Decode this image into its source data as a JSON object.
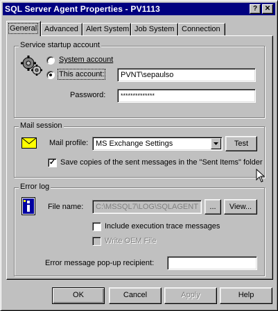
{
  "window": {
    "title": "SQL Server Agent Properties - PV1113",
    "help_button": "?",
    "close_button": "✕"
  },
  "tabs": [
    {
      "label": "General",
      "active": true
    },
    {
      "label": "Advanced",
      "active": false
    },
    {
      "label": "Alert System",
      "active": false
    },
    {
      "label": "Job System",
      "active": false
    },
    {
      "label": "Connection",
      "active": false
    }
  ],
  "service": {
    "group_label": "Service startup account",
    "system_account_label": "System account",
    "this_account_label": "This account:",
    "account_value": "PVNT\\sepaulso",
    "password_label": "Password:",
    "password_value": "**************"
  },
  "mail": {
    "group_label": "Mail session",
    "profile_label": "Mail profile:",
    "profile_value": "MS Exchange Settings",
    "test_button": "Test",
    "save_copies_label": "Save copies of the sent messages in the \"Sent Items\" folder",
    "save_copies_checked": true
  },
  "errorlog": {
    "group_label": "Error log",
    "file_name_label": "File name:",
    "file_name_value": "C:\\MSSQL7\\LOG\\SQLAGENT",
    "browse_button": "...",
    "view_button": "View...",
    "include_trace_label": "Include execution trace messages",
    "write_oem_label": "Write OEM File",
    "popup_label": "Error message pop-up recipient:",
    "popup_value": ""
  },
  "footer": {
    "ok": "OK",
    "cancel": "Cancel",
    "apply": "Apply",
    "help": "Help"
  },
  "colors": {
    "titlebar": "#000080",
    "face": "#c0c0c0"
  }
}
